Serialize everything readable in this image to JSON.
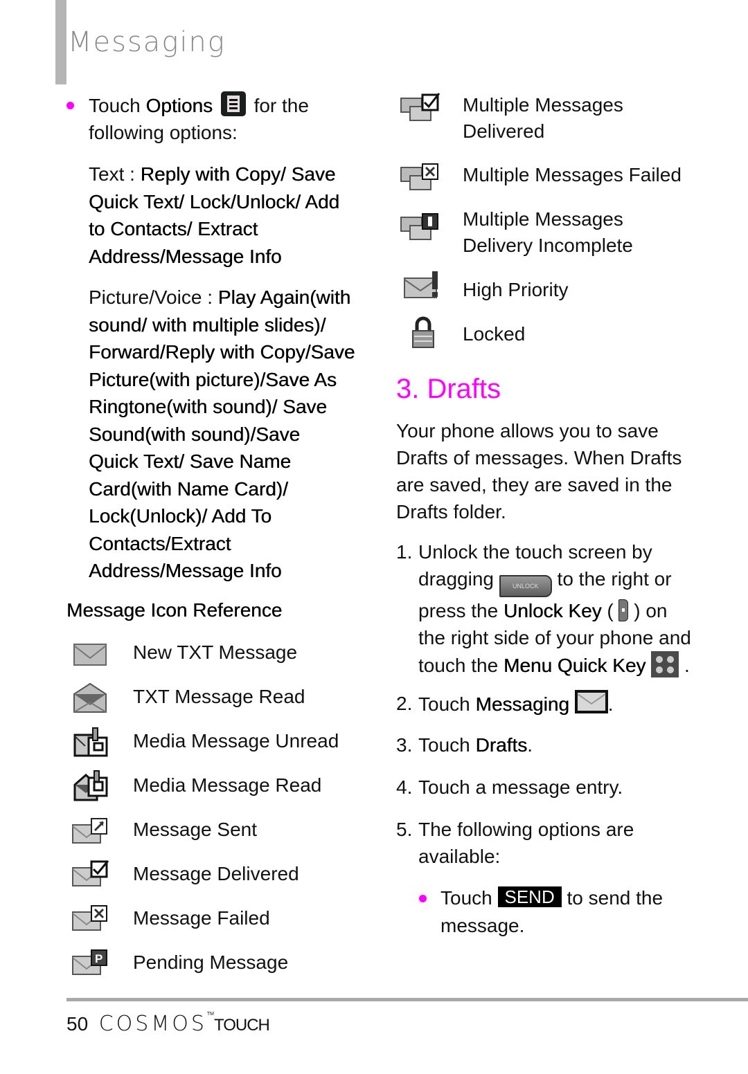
{
  "header": {
    "title": "Messaging"
  },
  "left": {
    "intro": {
      "pre": "Touch ",
      "bold": "Options",
      "post": " for the",
      "line2": "following options:"
    },
    "text_options": {
      "lines": [
        {
          "plain": "Text : ",
          "bold": "Reply with Copy/ Save"
        },
        {
          "plain": "",
          "bold": "Quick Text/ Lock/Unlock/ Add"
        },
        {
          "plain": "",
          "bold": "to Contacts/ Extract"
        },
        {
          "plain": "",
          "bold": "Address/Message Info"
        }
      ]
    },
    "picture_options": {
      "lines": [
        {
          "plain": "Picture/Voice : ",
          "bold": "Play Again(with"
        },
        {
          "plain": "",
          "bold": "sound/ with multiple slides)/"
        },
        {
          "plain": "",
          "bold": "Forward/Reply with Copy/Save"
        },
        {
          "plain": "",
          "bold": "Picture(with picture)/Save As"
        },
        {
          "plain": "",
          "bold": "Ringtone(with sound)/ Save"
        },
        {
          "plain": "",
          "bold": "Sound(with sound)/Save"
        },
        {
          "plain": "",
          "bold": "Quick Text/ Save Name"
        },
        {
          "plain": "",
          "bold": "Card(with Name Card)/"
        },
        {
          "plain": "",
          "bold": "Lock(Unlock)/ Add To"
        },
        {
          "plain": "",
          "bold": "Contacts/Extract"
        },
        {
          "plain": "",
          "bold": "Address/Message Info"
        }
      ]
    },
    "icon_ref_heading": "Message Icon Reference",
    "icons": [
      {
        "icon": "envelope-closed-icon",
        "label": "New TXT Message"
      },
      {
        "icon": "envelope-open-icon",
        "label": "TXT Message Read"
      },
      {
        "icon": "media-unread-icon",
        "label": "Media Message Unread"
      },
      {
        "icon": "media-read-icon",
        "label": "Media Message Read"
      },
      {
        "icon": "message-sent-icon",
        "label": "Message Sent"
      },
      {
        "icon": "message-delivered-icon",
        "label": "Message Delivered"
      },
      {
        "icon": "message-failed-icon",
        "label": "Message Failed"
      },
      {
        "icon": "pending-message-icon",
        "label": "Pending Message"
      }
    ]
  },
  "right": {
    "icons": [
      {
        "icon": "multi-delivered-icon",
        "label": "Multiple Messages",
        "label2": "Delivered"
      },
      {
        "icon": "multi-failed-icon",
        "label": "Multiple Messages Failed",
        "label2": ""
      },
      {
        "icon": "multi-incomplete-icon",
        "label": "Multiple Messages",
        "label2": "Delivery Incomplete"
      },
      {
        "icon": "high-priority-icon",
        "label": "High Priority",
        "label2": ""
      },
      {
        "icon": "lock-icon",
        "label": "Locked",
        "label2": ""
      }
    ],
    "section_title": "3. Drafts",
    "section_color": "#ff00ff",
    "intro_lines": [
      "Your phone allows you to save",
      "Drafts of messages. When Drafts",
      "are saved, they are saved in the",
      "Drafts folder."
    ],
    "steps": {
      "s1": {
        "num": "1.",
        "l1": "Unlock the touch screen by",
        "l2a": "dragging ",
        "unlock_btn": "UNLOCK",
        "l2b": " to the right or",
        "l3a": "press the ",
        "l3bold": "Unlock Key",
        "l3b": " ( ",
        "l3c": " ) on",
        "l4": "the right side of your phone and",
        "l5a": "touch the ",
        "l5bold": "Menu Quick Key",
        "l5b": " ."
      },
      "s2": {
        "num": "2.",
        "pre": "Touch ",
        "bold": "Messaging",
        "post": "."
      },
      "s3": {
        "num": "3.",
        "pre": "Touch ",
        "bold": "Drafts",
        "post": "."
      },
      "s4": {
        "num": "4.",
        "text": "Touch a message entry."
      },
      "s5": {
        "num": "5.",
        "l1": "The following options are",
        "l2": "available:"
      },
      "bullet": {
        "pre": "Touch ",
        "key": "SEND",
        "post": " to send the",
        "l2": "message."
      }
    }
  },
  "footer": {
    "page": "50",
    "brand": "COSMOS",
    "tm": "TM",
    "suffix": "TOUCH"
  }
}
